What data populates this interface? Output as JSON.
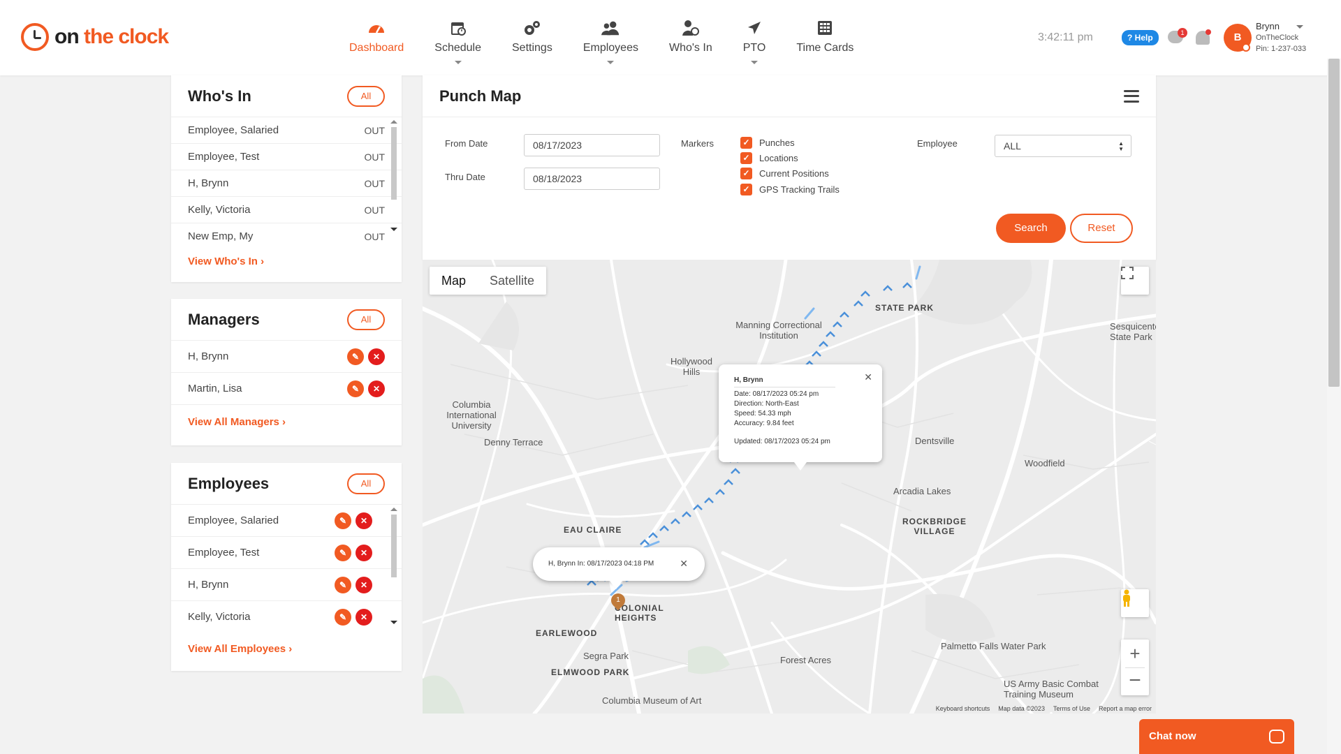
{
  "logo": {
    "on": "on",
    "the": "the",
    "clock": "clock"
  },
  "nav": [
    {
      "label": "Dashboard",
      "icon": "speedometer-icon"
    },
    {
      "label": "Schedule",
      "icon": "calendar-icon"
    },
    {
      "label": "Settings",
      "icon": "gears-icon"
    },
    {
      "label": "Employees",
      "icon": "users-icon"
    },
    {
      "label": "Who's In",
      "icon": "user-clock-icon"
    },
    {
      "label": "PTO",
      "icon": "airplane-icon"
    },
    {
      "label": "Time Cards",
      "icon": "timecard-icon"
    }
  ],
  "header": {
    "time": "3:42:11 pm",
    "help": "? Help",
    "messages_count": "1",
    "avatar_letter": "B",
    "user_name": "Brynn",
    "company": "OnTheClock",
    "pin": "Pin: 1-237-033"
  },
  "whos_in": {
    "title": "Who's In",
    "all": "All",
    "rows": [
      {
        "name": "Employee, Salaried",
        "status": "OUT"
      },
      {
        "name": "Employee, Test",
        "status": "OUT"
      },
      {
        "name": "H, Brynn",
        "status": "OUT"
      },
      {
        "name": "Kelly, Victoria",
        "status": "OUT"
      },
      {
        "name": "New Emp, My",
        "status": "OUT"
      }
    ],
    "link": "View Who's In ›"
  },
  "managers": {
    "title": "Managers",
    "all": "All",
    "rows": [
      {
        "name": "H, Brynn"
      },
      {
        "name": "Martin, Lisa"
      }
    ],
    "link": "View All Managers ›"
  },
  "employees": {
    "title": "Employees",
    "all": "All",
    "rows": [
      {
        "name": "Employee, Salaried"
      },
      {
        "name": "Employee, Test"
      },
      {
        "name": "H, Brynn"
      },
      {
        "name": "Kelly, Victoria"
      }
    ],
    "link": "View All Employees ›"
  },
  "punch_map": {
    "title": "Punch Map",
    "from_label": "From Date",
    "from_value": "08/17/2023",
    "thru_label": "Thru Date",
    "thru_value": "08/18/2023",
    "markers_label": "Markers",
    "markers": [
      "Punches",
      "Locations",
      "Current Positions",
      "GPS Tracking Trails"
    ],
    "employee_label": "Employee",
    "employee_value": "ALL",
    "search": "Search",
    "reset": "Reset"
  },
  "map": {
    "tab_map": "Map",
    "tab_satellite": "Satellite",
    "popup1": {
      "name": "H, Brynn",
      "date": "Date: 08/17/2023 05:24 pm",
      "direction": "Direction: North-East",
      "speed": "Speed: 54.33 mph",
      "accuracy": "Accuracy: 9.84 feet",
      "updated": "Updated: 08/17/2023 05:24 pm"
    },
    "popup2": {
      "text": "H, Brynn In: 08/17/2023 04:18 PM"
    },
    "marker_label": "1",
    "places": [
      {
        "name": "STATE PARK",
        "bold": true
      },
      {
        "name": "Manning Correctional Institution"
      },
      {
        "name": "Hollywood Hills"
      },
      {
        "name": "Columbia International University"
      },
      {
        "name": "Denny Terrace"
      },
      {
        "name": "Dentsville"
      },
      {
        "name": "Woodfield"
      },
      {
        "name": "Arcadia Lakes"
      },
      {
        "name": "ROCKBRIDGE VILLAGE",
        "bold": true
      },
      {
        "name": "EAU CLAIRE",
        "bold": true
      },
      {
        "name": "COLONIAL HEIGHTS",
        "bold": true
      },
      {
        "name": "EARLEWOOD",
        "bold": true
      },
      {
        "name": "Segra Park"
      },
      {
        "name": "ELMWOOD PARK",
        "bold": true
      },
      {
        "name": "Forest Acres"
      },
      {
        "name": "Palmetto Falls Water Park"
      },
      {
        "name": "US Army Basic Combat Training Museum"
      },
      {
        "name": "Columbia Museum of Art"
      },
      {
        "name": "Sesquicentennial State Park"
      }
    ],
    "attribution": [
      "Keyboard shortcuts",
      "Map data ©2023",
      "Terms of Use",
      "Report a map error"
    ]
  },
  "chat": {
    "label": "Chat now"
  }
}
